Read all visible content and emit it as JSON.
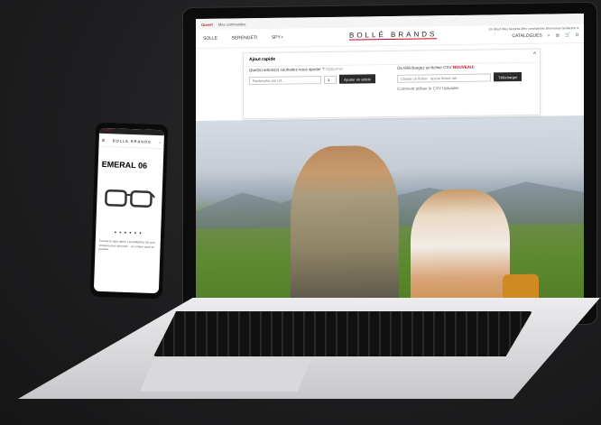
{
  "laptop": {
    "topbar": {
      "tag": "Ouvert",
      "links": "Mes commandes"
    },
    "nav": {
      "links": [
        "SOLLE",
        "SERENGETI",
        "SPY+"
      ],
      "brand": "BOLLÉ BRANDS",
      "account": "En direct   Mes factures   Mes commandes   Bienvenue Guillaume ▾",
      "catalogues": "CATALOGUES",
      "cart_count": "0"
    },
    "order_panel": {
      "title": "Ajout rapide",
      "left_label": "Quel(s) article(s) souhaitez-vous ajouter ?",
      "left_hint": "Optionnel",
      "search_placeholder": "Recherche par ref...",
      "qty": "1",
      "add_button": "Ajouter un article",
      "right_label": "Ou téléchargez un fichier CSV",
      "new_badge": "NOUVEAU!",
      "file_placeholder": "Choisir un fichier   aucun fichier sél.",
      "upload_button": "Télécharger",
      "help_link": "Comment utiliser le CSV Uploader"
    }
  },
  "phone": {
    "topbar": "Ouvert",
    "brand": "BOLLÉ BRANDS",
    "product_title": "EMERAL 06",
    "pager": "● ● ● ● ● ●",
    "description": "Il existe le type miroir. Les EMERAL 06 sont conçues pour procurer... un confort toute la journée."
  }
}
